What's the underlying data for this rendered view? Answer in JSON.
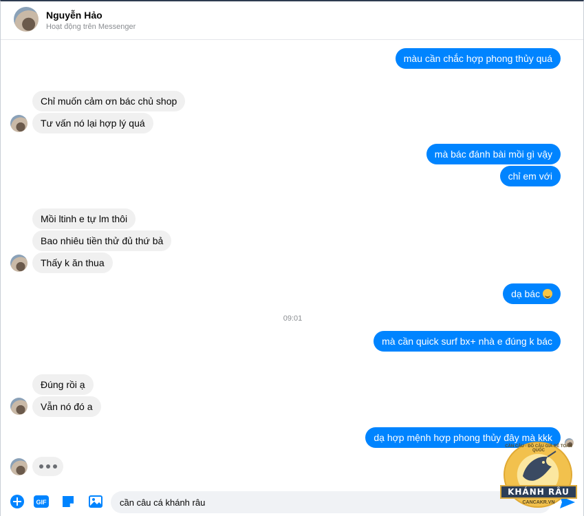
{
  "header": {
    "name": "Nguyễn Hảo",
    "status": "Hoạt động trên Messenger"
  },
  "messages": [
    {
      "side": "out",
      "text": "màu cần chắc hợp phong thủy quá"
    },
    {
      "side": "in",
      "text": "Chỉ muốn cảm ơn bác chủ shop"
    },
    {
      "side": "in",
      "text": "Tư vấn nó lại hợp lý quá"
    },
    {
      "side": "out",
      "text": "mà bác đánh bài mồi gì vậy"
    },
    {
      "side": "out",
      "text": "chỉ em với"
    },
    {
      "side": "in",
      "text": "Mồi ltinh e tự lm thôi"
    },
    {
      "side": "in",
      "text": "Bao nhiêu tiền thử đủ thứ bả"
    },
    {
      "side": "in",
      "text": "Thấy k ăn thua"
    },
    {
      "side": "out",
      "text": "dạ bác",
      "emoji": "smile-emoji"
    },
    {
      "side": "out",
      "text": "mà cần quick surf bx+ nhà e đúng k bác"
    },
    {
      "side": "in",
      "text": "Đúng rồi ạ"
    },
    {
      "side": "in",
      "text": "Vẫn nó đó a"
    },
    {
      "side": "out",
      "text": "dạ hợp mệnh hợp phong thủy đây mà kkk"
    }
  ],
  "timestamp": "09:01",
  "composer": {
    "input_value": "cần câu cá khánh râu",
    "gif_label": "GIF",
    "accent": "#0084ff"
  },
  "watermark": {
    "brand": "KHÁNH RÂU",
    "site": "CANCAKR.VN",
    "tagline": "CẦN CÂU - ĐỒ CÂU GIÁ RẺ TOÀN QUỐC"
  }
}
